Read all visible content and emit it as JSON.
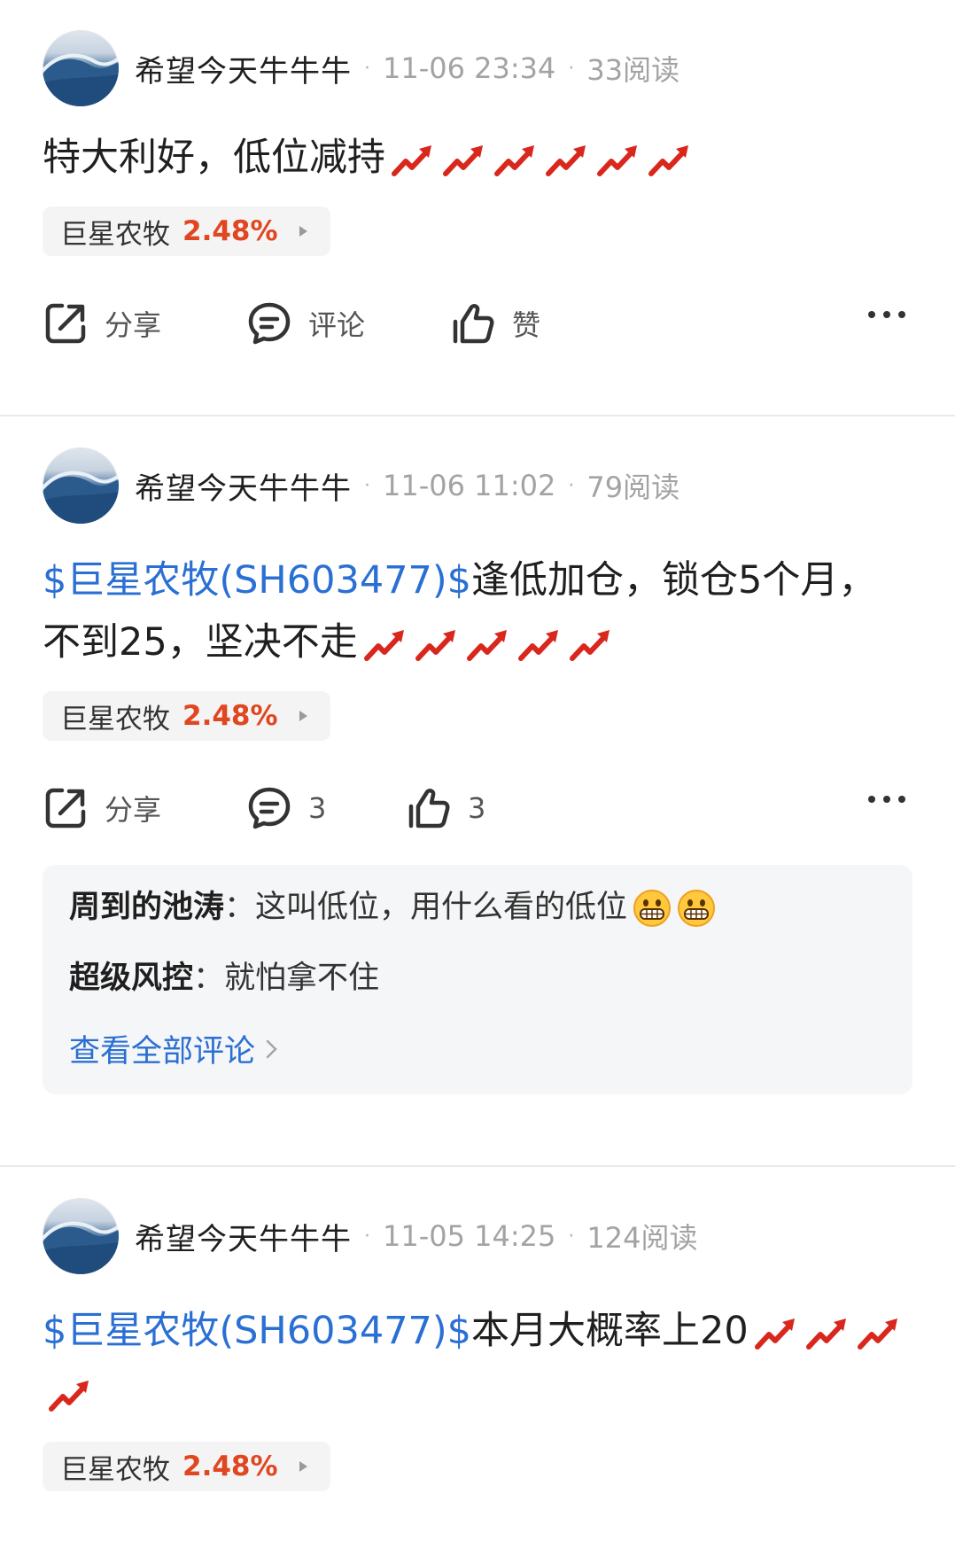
{
  "posts": [
    {
      "user": "希望今天牛牛牛",
      "time": "11-06 23:34",
      "reads": "33阅读",
      "link": "",
      "text": "特大利好，低位减持",
      "trend_count": 6,
      "stock": {
        "name": "巨星农牧",
        "change": "2.48%"
      },
      "actions": {
        "share": "分享",
        "comment": "评论",
        "like": "赞"
      }
    },
    {
      "user": "希望今天牛牛牛",
      "time": "11-06 11:02",
      "reads": "79阅读",
      "link": "$巨星农牧(SH603477)$",
      "text": "逢低加仓，锁仓5个月，不到25，坚决不走",
      "trend_count": 5,
      "stock": {
        "name": "巨星农牧",
        "change": "2.48%"
      },
      "actions": {
        "share": "分享",
        "comment": "3",
        "like": "3"
      },
      "comments": [
        {
          "user": "周到的池涛",
          "sep": "：",
          "text": "这叫低位，用什么看的低位"
        },
        {
          "user": "超级风控",
          "sep": "：",
          "text": "就怕拿不住"
        }
      ],
      "view_all": "查看全部评论"
    },
    {
      "user": "希望今天牛牛牛",
      "time": "11-05 14:25",
      "reads": "124阅读",
      "link": "$巨星农牧(SH603477)$",
      "text": "本月大概率上20",
      "trend_count": 4,
      "stock": {
        "name": "巨星农牧",
        "change": "2.48%"
      }
    }
  ],
  "colors": {
    "link": "#2a6fd3",
    "rise": "#e0461f",
    "meta": "#a3a3a3"
  },
  "icons": [
    "share-icon",
    "comment-icon",
    "like-icon",
    "more-icon",
    "chart-increasing-emoji",
    "grinning-emoji"
  ]
}
